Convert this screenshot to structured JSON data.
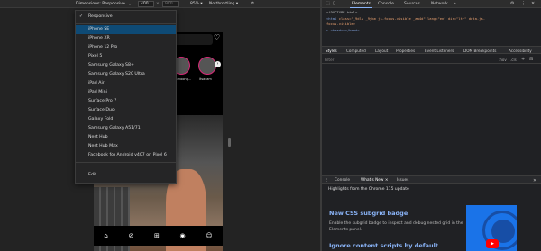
{
  "device_toolbar": {
    "dimensions_label": "Dimensions: Responsive",
    "chevron": "▾",
    "width_value": "400",
    "times": "×",
    "height_value": "900",
    "zoom": "85% ▾",
    "throttle": "No throttling ▾",
    "rotate_icon": "⟳"
  },
  "device_menu": {
    "responsive": "Responsive",
    "check": "✓",
    "devices": [
      "iPhone SE",
      "iPhone XR",
      "iPhone 12 Pro",
      "Pixel 5",
      "Samsung Galaxy S8+",
      "Samsung Galaxy S20 Ultra",
      "iPad Air",
      "iPad Mini",
      "Surface Pro 7",
      "Surface Duo",
      "Galaxy Fold",
      "Samsung Galaxy A51/71",
      "Nest Hub",
      "Nest Hub Max",
      "Facebook for Android v407 on Pixel 6"
    ],
    "edit": "Edit..."
  },
  "phone": {
    "stories": [
      "",
      "aldenmoong...",
      "itsacam"
    ],
    "next_icon": "›",
    "heart_icon": "♡",
    "nav_icons": [
      "⌂",
      "⊘",
      "⊞",
      "◉",
      "☺"
    ]
  },
  "devtools": {
    "top_tabs": [
      "Elements",
      "Console",
      "Sources",
      "Network",
      "»"
    ],
    "settings_icon": "⚙",
    "kebab_icon": "⋮",
    "close_icon": "✕",
    "dom": {
      "line1": "<!DOCTYPE html>",
      "line2_tag": "<html",
      "line2_attrs": " class=\"_9dls _9ykm js-focus-visible _aa4d\" lang=\"en\" dir=\"ltr\" data-js-",
      "line3": "focus-visible>",
      "line4": "▸ <head>⋯</head>"
    },
    "styles_tabs": [
      "Styles",
      "Computed",
      "Layout",
      "Properties",
      "Event Listeners",
      "DOM Breakpoints",
      "Accessibility"
    ],
    "filter_placeholder": "Filter",
    "hov": ":hov",
    "cls": ".cls",
    "plus": "+",
    "more": "⊟",
    "drawer_tabs": [
      "Console",
      "What's New ×",
      "Issues"
    ],
    "drawer_menu_icon": "⋮",
    "whats_new": {
      "highlights": "Highlights from the Chrome 115 update",
      "title1": "New CSS subgrid badge",
      "desc1": "Enable the subgrid badge to inspect and debug nested grid in the Elements panel.",
      "title2": "Ignore content scripts by default",
      "play_icon": "▶"
    }
  }
}
